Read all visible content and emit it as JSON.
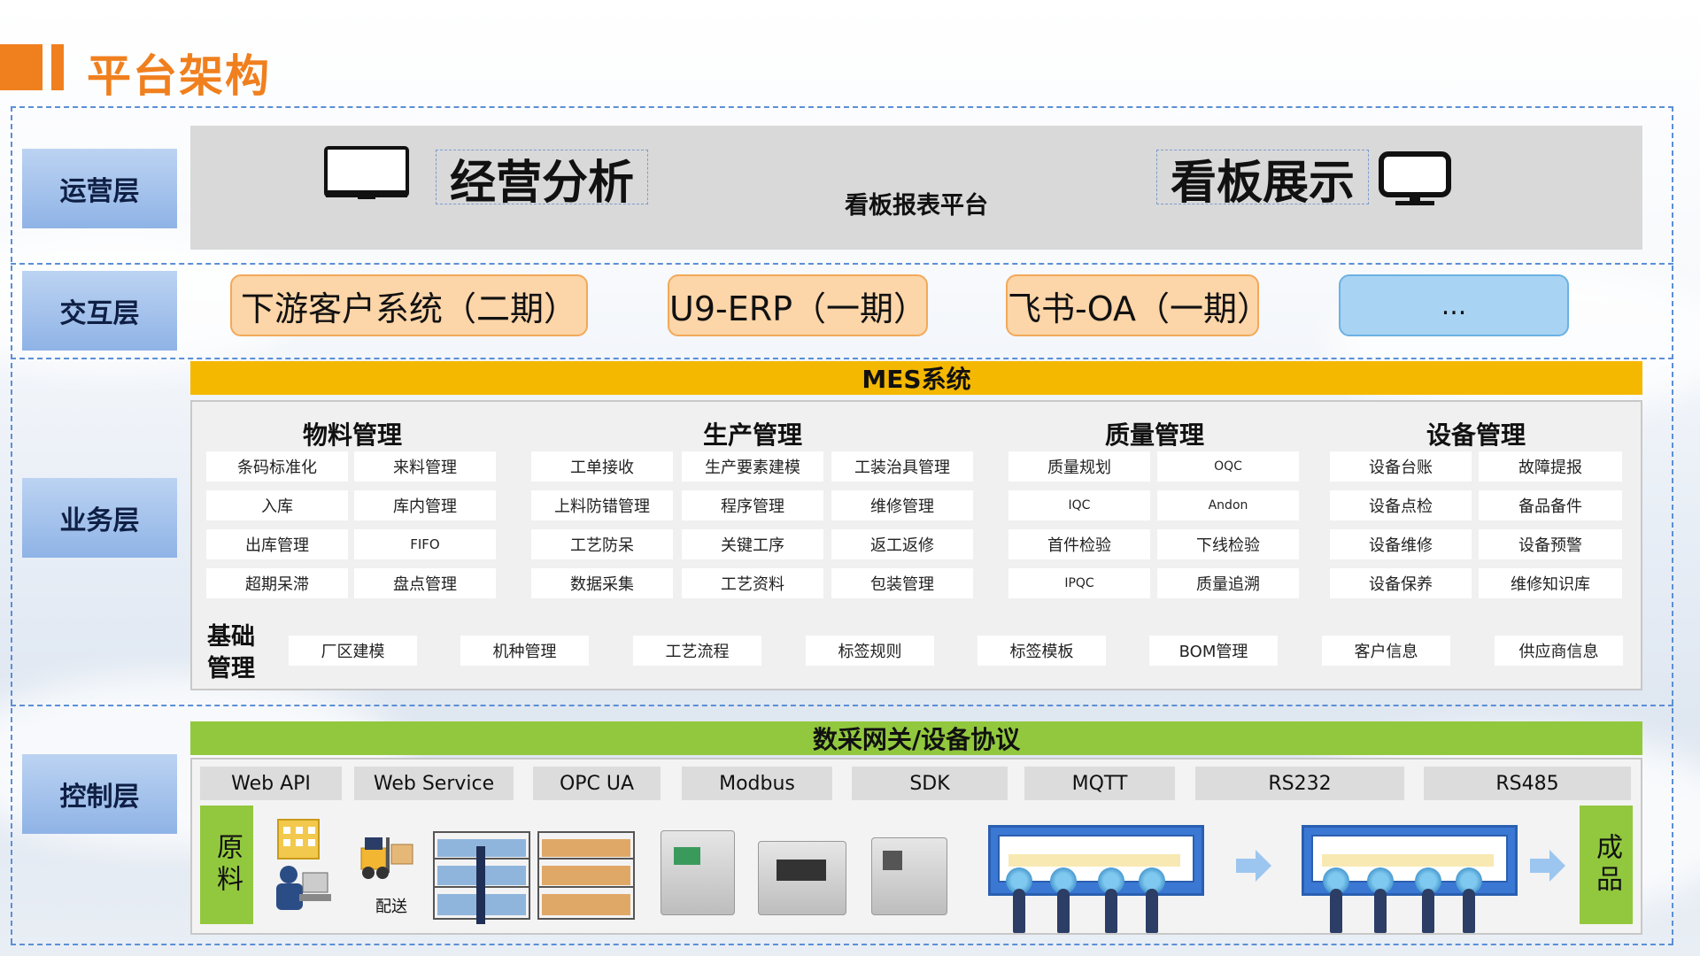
{
  "title": "平台架构",
  "colors": {
    "accent": "#f07f1e",
    "mes": "#f5b800",
    "gateway": "#92c83e",
    "layer_label": "#8fb3e6",
    "dashed": "#5b8fd6"
  },
  "layers": {
    "ops": "运营层",
    "interaction": "交互层",
    "business": "业务层",
    "control": "控制层"
  },
  "ops": {
    "analysis": "经营分析",
    "platform": "看板报表平台",
    "dashboard": "看板展示",
    "icons": [
      "monitor-icon",
      "desktop-icon"
    ]
  },
  "interaction": {
    "systems": [
      "下游客户系统（二期）",
      "U9-ERP（一期）",
      "飞书-OA（一期）",
      "..."
    ]
  },
  "mes": {
    "title": "MES系统",
    "groups": {
      "material": {
        "title": "物料管理",
        "items": [
          "条码标准化",
          "来料管理",
          "入库",
          "库内管理",
          "出库管理",
          "FIFO",
          "超期呆滞",
          "盘点管理"
        ]
      },
      "production": {
        "title": "生产管理",
        "items": [
          "工单接收",
          "生产要素建模",
          "工装治具管理",
          "上料防错管理",
          "程序管理",
          "维修管理",
          "工艺防呆",
          "关键工序",
          "返工返修",
          "数据采集",
          "工艺资料",
          "包装管理"
        ]
      },
      "quality": {
        "title": "质量管理",
        "items": [
          "质量规划",
          "OQC",
          "IQC",
          "Andon",
          "首件检验",
          "下线检验",
          "IPQC",
          "质量追溯"
        ]
      },
      "equipment": {
        "title": "设备管理",
        "items": [
          "设备台账",
          "故障提报",
          "设备点检",
          "备品备件",
          "设备维修",
          "设备预警",
          "设备保养",
          "维修知识库"
        ]
      }
    },
    "base": {
      "title_line1": "基础",
      "title_line2": "管理",
      "items": [
        "厂区建模",
        "机种管理",
        "工艺流程",
        "标签规则",
        "标签模板",
        "BOM管理",
        "客户信息",
        "供应商信息"
      ]
    }
  },
  "gateway": {
    "title": "数采网关/设备协议",
    "protocols": [
      "Web API",
      "Web Service",
      "OPC UA",
      "Modbus",
      "SDK",
      "MQTT",
      "RS232",
      "RS485"
    ]
  },
  "control": {
    "raw": "原料",
    "finished": "成品",
    "delivery": "配送"
  }
}
